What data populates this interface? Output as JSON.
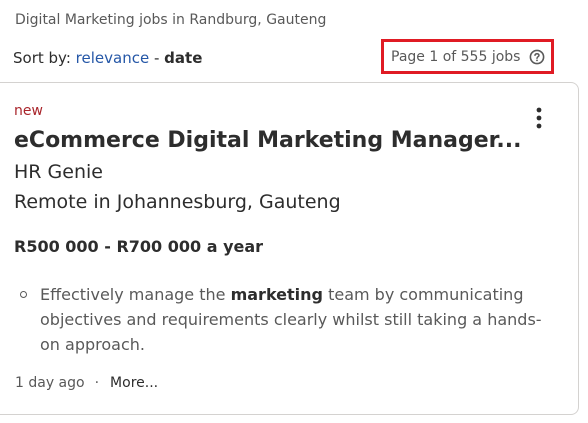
{
  "search_heading": "Digital Marketing jobs in Randburg, Gauteng",
  "sort": {
    "label": "Sort by:",
    "relevance": "relevance",
    "separator": "-",
    "date": "date"
  },
  "page_count": "Page 1 of 555 jobs",
  "job": {
    "badge": "new",
    "title": "eCommerce Digital Marketing Manager...",
    "company": "HR Genie",
    "location": "Remote in Johannesburg, Gauteng",
    "salary": "R500 000 - R700 000 a year",
    "snippet": {
      "before": "Effectively manage the ",
      "highlight": "marketing",
      "after": " team by communicating objectives and requirements clearly whilst still taking a hands-on approach."
    },
    "posted": "1 day ago",
    "separator": "·",
    "more": "More..."
  },
  "colors": {
    "link": "#2557a7",
    "badge": "#a9252b",
    "highlight_border": "#e01b24"
  },
  "icons": {
    "help": "help-circle-icon",
    "menu": "more-vertical-icon"
  }
}
